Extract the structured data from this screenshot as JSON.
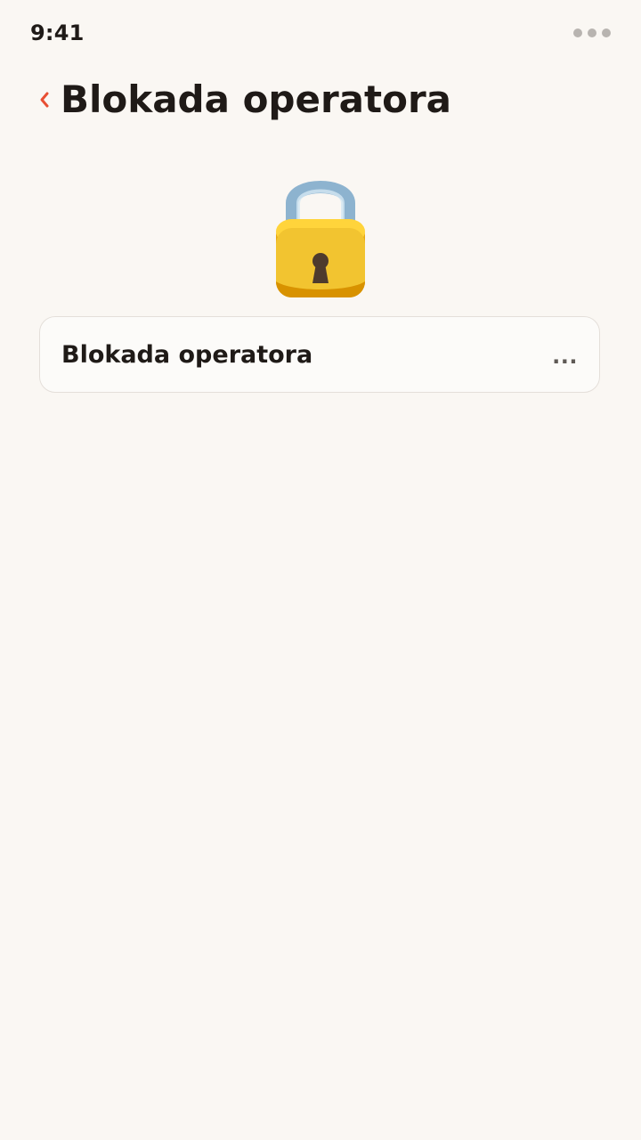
{
  "status_bar": {
    "time": "9:41",
    "menu_icon": "more-horizontal-icon"
  },
  "header": {
    "back_icon": "chevron-left-icon",
    "title": "Blokada operatora"
  },
  "hero": {
    "icon": "padlock-icon"
  },
  "list": {
    "items": [
      {
        "label": "Blokada operatora",
        "value": "..."
      }
    ]
  },
  "colors": {
    "background": "#faf7f3",
    "accent": "#e84f33",
    "card_border": "#e4dfda",
    "padlock_body": "#f2c430",
    "padlock_shackle": "#8db3cf"
  }
}
